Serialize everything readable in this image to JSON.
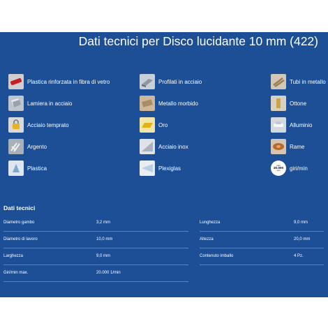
{
  "title": "Dati tecnici per Disco lucidante 10 mm (422)",
  "materials": [
    {
      "label": "Plastica rinforzata in fibra di vetro",
      "icon": "fiberglass-plastic-icon"
    },
    {
      "label": "Profilati in acciaio",
      "icon": "steel-profile-icon"
    },
    {
      "label": "Tubi in metallo",
      "icon": "metal-pipes-icon"
    },
    {
      "label": "Lamiera in acciaio",
      "icon": "steel-sheet-icon"
    },
    {
      "label": "Metallo morbido",
      "icon": "soft-metal-icon"
    },
    {
      "label": "Ottone",
      "icon": "brass-icon"
    },
    {
      "label": "Acciaio temprato",
      "icon": "hardened-steel-icon"
    },
    {
      "label": "Oro",
      "icon": "gold-icon"
    },
    {
      "label": "Alluminio",
      "icon": "aluminium-icon"
    },
    {
      "label": "Argento",
      "icon": "silver-icon"
    },
    {
      "label": "Acciaio inox",
      "icon": "stainless-steel-icon"
    },
    {
      "label": "Rame",
      "icon": "copper-icon"
    },
    {
      "label": "Plastica",
      "icon": "plastic-icon"
    },
    {
      "label": "Plexiglas",
      "icon": "plexiglas-icon"
    },
    {
      "label": "giri/min",
      "icon": "rpm-icon",
      "icon_text": [
        "max",
        "20.000",
        "min"
      ]
    }
  ],
  "tech_title": "Dati tecnici",
  "specs_left": [
    {
      "label": "Diametro gambo",
      "value": "3,2 mm"
    },
    {
      "label": "Diametro di lavoro",
      "value": "10,0 mm"
    },
    {
      "label": "Larghezza",
      "value": "9,0 mm"
    },
    {
      "label": "Giri/min max.",
      "value": "20.000 1/min"
    }
  ],
  "specs_right": [
    {
      "label": "Lunghezza",
      "value": "9,0 mm"
    },
    {
      "label": "Altezza",
      "value": "20,0 mm"
    },
    {
      "label": "Contenuto imballo",
      "value": "4 Pz."
    }
  ],
  "colors": {
    "panel": "#1d4f96",
    "divider": "#5d83ba"
  }
}
